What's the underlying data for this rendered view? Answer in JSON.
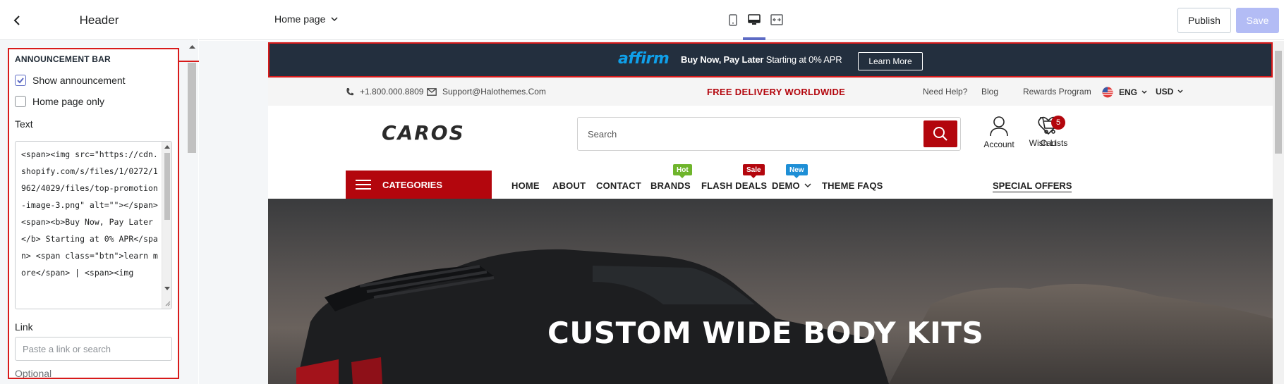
{
  "editor": {
    "sidebar": {
      "title": "Header",
      "section_title": "ANNOUNCEMENT BAR",
      "show_announcement": {
        "label": "Show announcement",
        "checked": true
      },
      "home_page_only": {
        "label": "Home page only",
        "checked": false
      },
      "text_label": "Text",
      "text_value": "<span><img src=\"https://cdn.shopify.com/s/files/1/0272/1962/4029/files/top-promotion-image-3.png\" alt=\"\"></span> <span><b>Buy Now, Pay Later</b> Starting at 0% APR</span> <span class=\"btn\">learn more</span> | <span><img",
      "link_label": "Link",
      "link_placeholder": "Paste a link or search",
      "optional_label": "Optional"
    },
    "topbar": {
      "page_select": "Home page",
      "devices": [
        "mobile-icon",
        "desktop-icon",
        "fullscreen-icon"
      ],
      "active_device": "desktop-icon",
      "publish_label": "Publish",
      "save_label": "Save"
    },
    "accent": "#5c6ac4"
  },
  "store": {
    "announcement": {
      "logo": "affirm",
      "bold_text": "Buy Now, Pay Later",
      "text": "Starting at 0% APR",
      "button": "Learn More",
      "bg_color": "#232f3e"
    },
    "topstrip": {
      "phone": "+1.800.000.8809",
      "email": "Support@Halothemes.Com",
      "promo": "FREE DELIVERY WORLDWIDE",
      "help": "Need Help?",
      "blog": "Blog",
      "rewards": "Rewards Program",
      "language": "ENG",
      "currency": "USD"
    },
    "header": {
      "logo": "CAROS",
      "search_placeholder": "Search",
      "account": "Account",
      "wishlist": "Wish Lists",
      "cart": "Cart",
      "cart_count": "5"
    },
    "nav": {
      "categories": "CATEGORIES",
      "items": [
        {
          "label": "HOME"
        },
        {
          "label": "ABOUT"
        },
        {
          "label": "CONTACT"
        },
        {
          "label": "BRANDS",
          "badge": "Hot",
          "badge_color": "#6fb52c"
        },
        {
          "label": "FLASH DEALS",
          "badge": "Sale",
          "badge_color": "#b3060d"
        },
        {
          "label": "DEMO",
          "badge": "New",
          "badge_color": "#1e8fd6"
        },
        {
          "label": "THEME FAQS"
        }
      ],
      "special": "SPECIAL OFFERS"
    },
    "hero": {
      "title": "CUSTOM WIDE BODY KITS"
    },
    "brand_color": "#b3060d"
  }
}
